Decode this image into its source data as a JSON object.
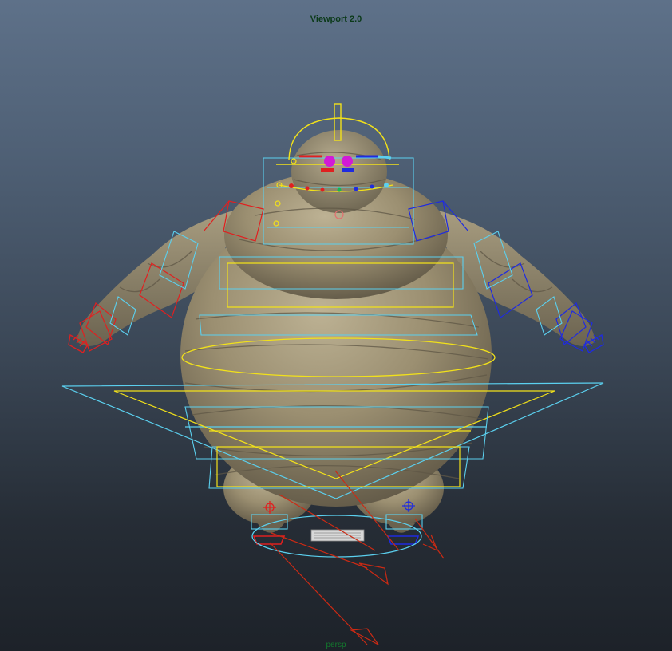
{
  "viewport": {
    "renderer_title": "Viewport 2.0",
    "camera_name": "persp",
    "background_top": "#5e7189",
    "background_bottom": "#1d2229"
  },
  "rig": {
    "character": "bandage-wrapped mummy",
    "colors": {
      "left_side_controls": "#e02020",
      "right_side_controls": "#1f2be0",
      "center_controls": "#f2e11a",
      "fk_boxes": "#5bd0ef",
      "joint_arrows": "#cc2a14",
      "body_skin": "#a89b7c"
    }
  }
}
